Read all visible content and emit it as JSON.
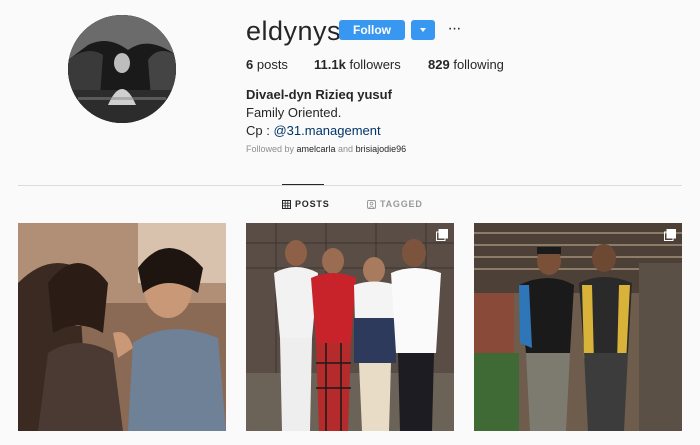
{
  "profile": {
    "username": "eldynysf",
    "follow_label": "Follow",
    "more_label": "···",
    "stats": {
      "posts_count": "6",
      "posts_label": "posts",
      "followers_count": "11.1k",
      "followers_label": "followers",
      "following_count": "829",
      "following_label": "following"
    },
    "bio": {
      "full_name": "Divael-dyn Rizieq yusuf",
      "line1": "Family Oriented.",
      "cp_prefix": "Cp : ",
      "cp_link": "@31.management"
    },
    "followed_by": {
      "prefix": "Followed by ",
      "user1": "amelcarla",
      "joiner": " and ",
      "user2": "brisiajodie96"
    }
  },
  "tabs": [
    {
      "label": "POSTS",
      "icon": "grid-icon",
      "active": true
    },
    {
      "label": "TAGGED",
      "icon": "tag-icon",
      "active": false
    }
  ],
  "posts": [
    {
      "icon": "photo",
      "multi": false
    },
    {
      "icon": "photo",
      "multi": true
    },
    {
      "icon": "photo",
      "multi": true
    }
  ],
  "colors": {
    "accent": "#3897f0",
    "link": "#003569",
    "background": "#fafafa",
    "muted": "#8e8e8e"
  }
}
